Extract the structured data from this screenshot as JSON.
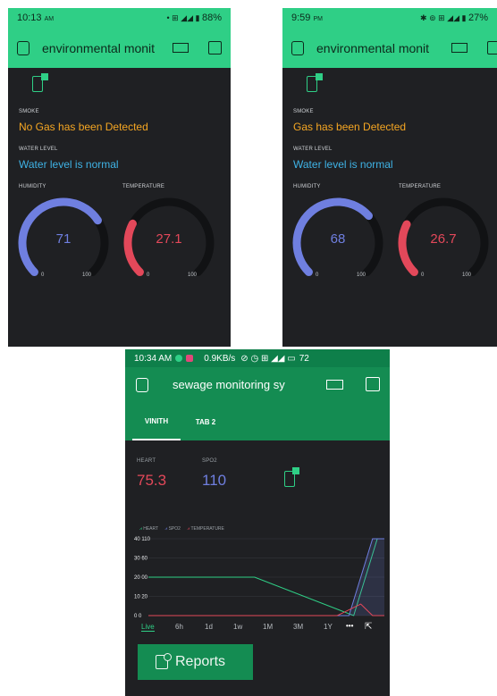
{
  "colors": {
    "green": "#2fcf86",
    "dark_green": "#148c52",
    "bg": "#1f2023",
    "orange": "#f5a623",
    "cyan": "#3fb3e6",
    "blue": "#6f7fe0",
    "red": "#e3485a"
  },
  "phone1": {
    "status": {
      "time": "10:13",
      "ampm": "AM",
      "battery": "88%"
    },
    "title": "environmental monit",
    "smoke_label": "SMOKE",
    "smoke_value": "No Gas has been Detected",
    "water_label": "WATER LEVEL",
    "water_value": "Water level is normal",
    "humidity_label": "HUMIDITY",
    "temperature_label": "TEMPERATURE",
    "humidity": {
      "value": "71",
      "min": "0",
      "max": "100",
      "fraction": 0.71
    },
    "temperature": {
      "value": "27.1",
      "min": "0",
      "max": "100",
      "fraction": 0.271
    }
  },
  "phone2": {
    "status": {
      "time": "9:59",
      "ampm": "PM",
      "battery": "27%"
    },
    "title": "environmental monit",
    "smoke_label": "SMOKE",
    "smoke_value": "Gas has been Detected",
    "water_label": "WATER LEVEL",
    "water_value": "Water level is normal",
    "humidity_label": "HUMIDITY",
    "temperature_label": "TEMPERATURE",
    "humidity": {
      "value": "68",
      "min": "0",
      "max": "100",
      "fraction": 0.68
    },
    "temperature": {
      "value": "26.7",
      "min": "0",
      "max": "100",
      "fraction": 0.267
    }
  },
  "phone3": {
    "status": {
      "time": "10:34 AM",
      "speed": "0.9KB/s",
      "battery": "72"
    },
    "title": "sewage monitoring sy",
    "tabs": [
      "VINITH",
      "TAB 2"
    ],
    "heart_label": "HEART",
    "heart_value": "75.3",
    "spo2_label": "SPO2",
    "spo2_value": "110",
    "legend": [
      "HEART",
      "SPO2",
      "TEMPERATURE"
    ],
    "ranges": [
      "Live",
      "6h",
      "1d",
      "1w",
      "1M",
      "3M",
      "1Y"
    ],
    "more": "•••",
    "reports": "Reports"
  },
  "chart_data": {
    "type": "line",
    "y_ticks": [
      "0 0",
      "10 20",
      "20 00",
      "30 60",
      "40 110"
    ],
    "series": [
      {
        "name": "HEART",
        "points": [
          [
            0,
            20
          ],
          [
            0.45,
            20
          ],
          [
            0.87,
            0
          ],
          [
            0.97,
            40
          ],
          [
            1,
            40
          ]
        ]
      },
      {
        "name": "SPO2",
        "points": [
          [
            0,
            0
          ],
          [
            0.85,
            0
          ],
          [
            0.95,
            40
          ],
          [
            1,
            40
          ]
        ]
      },
      {
        "name": "TEMPERATURE",
        "points": [
          [
            0,
            0
          ],
          [
            0.8,
            0
          ],
          [
            0.9,
            6
          ],
          [
            0.95,
            0
          ],
          [
            1,
            0
          ]
        ]
      }
    ],
    "ylim": [
      0,
      40
    ]
  }
}
